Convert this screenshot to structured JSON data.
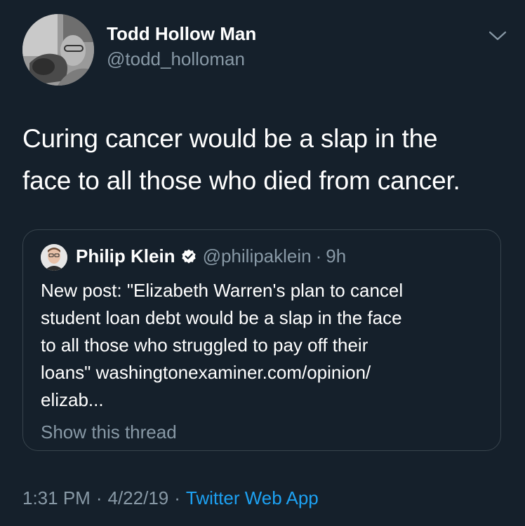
{
  "author": {
    "display_name": "Todd Hollow Man",
    "handle": "@todd_holloman"
  },
  "tweet": {
    "text_lines": [
      "Curing cancer would be a slap in the",
      "face to all those who died from cancer."
    ]
  },
  "quoted_tweet": {
    "display_name": "Philip Klein",
    "handle": "@philipaklein",
    "separator": "·",
    "time": "9h",
    "text_lines": [
      "New post: \"Elizabeth Warren's plan to cancel",
      "student loan debt would be a slap in the face",
      "to all those who struggled to pay off their",
      "loans\" washingtonexaminer.com/opinion/",
      "elizab..."
    ],
    "show_thread": "Show this thread"
  },
  "meta": {
    "time": "1:31 PM",
    "separator": "·",
    "date": "4/22/19",
    "app": "Twitter Web App"
  },
  "icons": {
    "menu": "chevron-down-icon",
    "verified": "verified-badge-icon"
  },
  "colors": {
    "background": "#15202b",
    "secondary_text": "#8899a6",
    "link": "#1da1f2",
    "border": "#38444d"
  }
}
